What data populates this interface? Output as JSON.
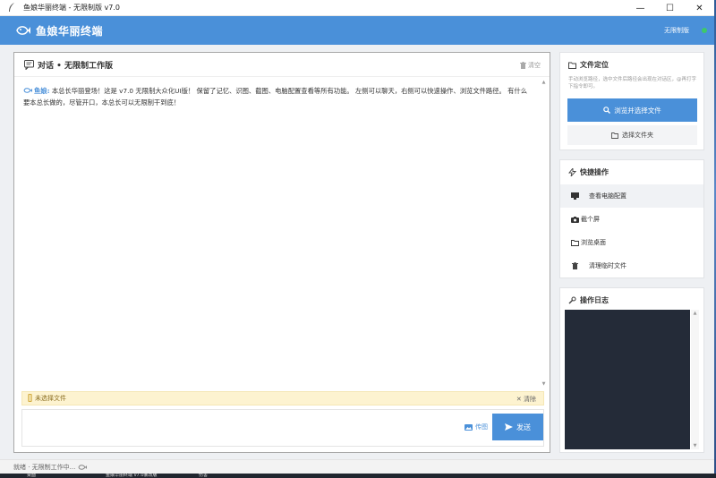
{
  "window": {
    "title": "鱼娘华丽终端 - 无限制版 v7.0",
    "minimize": "—",
    "maximize": "☐",
    "close": "✕"
  },
  "header": {
    "brand": "鱼娘华丽终端",
    "badge": "无限制版",
    "status_color": "#3ec86a",
    "accent": "#4a90d9"
  },
  "chat": {
    "title": "对话 • 无限制工作版",
    "clear_label": "清空",
    "message": {
      "speaker": "鱼娘:",
      "text": " 本总长华丽登场！这是 v7.0 无限制大众化UI版！ 保留了记忆、识图、截图、电脑配置查看等所有功能。 左侧可以聊天，右侧可以快速操作、浏览文件路径。 有什么要本总长做的，尽管开口，本总长可以无限制干到底！"
    },
    "file_status": "未选择文件",
    "file_clear": "✕ 清除",
    "image_button": "传图",
    "send_button": "发送"
  },
  "sidebar": {
    "file_locate": {
      "title": "文件定位",
      "description": "手动浏览路径，选中文件后路径会出现在对话区，@再打字下指令即可。",
      "browse_button": "浏览并选择文件",
      "folder_button": "选择文件夹"
    },
    "quick_ops": {
      "title": "快捷操作",
      "items": [
        {
          "label": "查看电脑配置",
          "icon": "monitor-icon"
        },
        {
          "label": "截个屏",
          "icon": "camera-icon"
        },
        {
          "label": "浏览桌面",
          "icon": "folder-icon"
        },
        {
          "label": "清理临时文件",
          "icon": "trash-icon"
        }
      ]
    },
    "log": {
      "title": "操作日志"
    }
  },
  "statusbar": {
    "text": "就绪 · 无限制工作中..."
  },
  "taskbar": {
    "items": [
      "桌面",
      "鱼娘华丽终端 v7.0暴改版",
      "伤害"
    ]
  }
}
